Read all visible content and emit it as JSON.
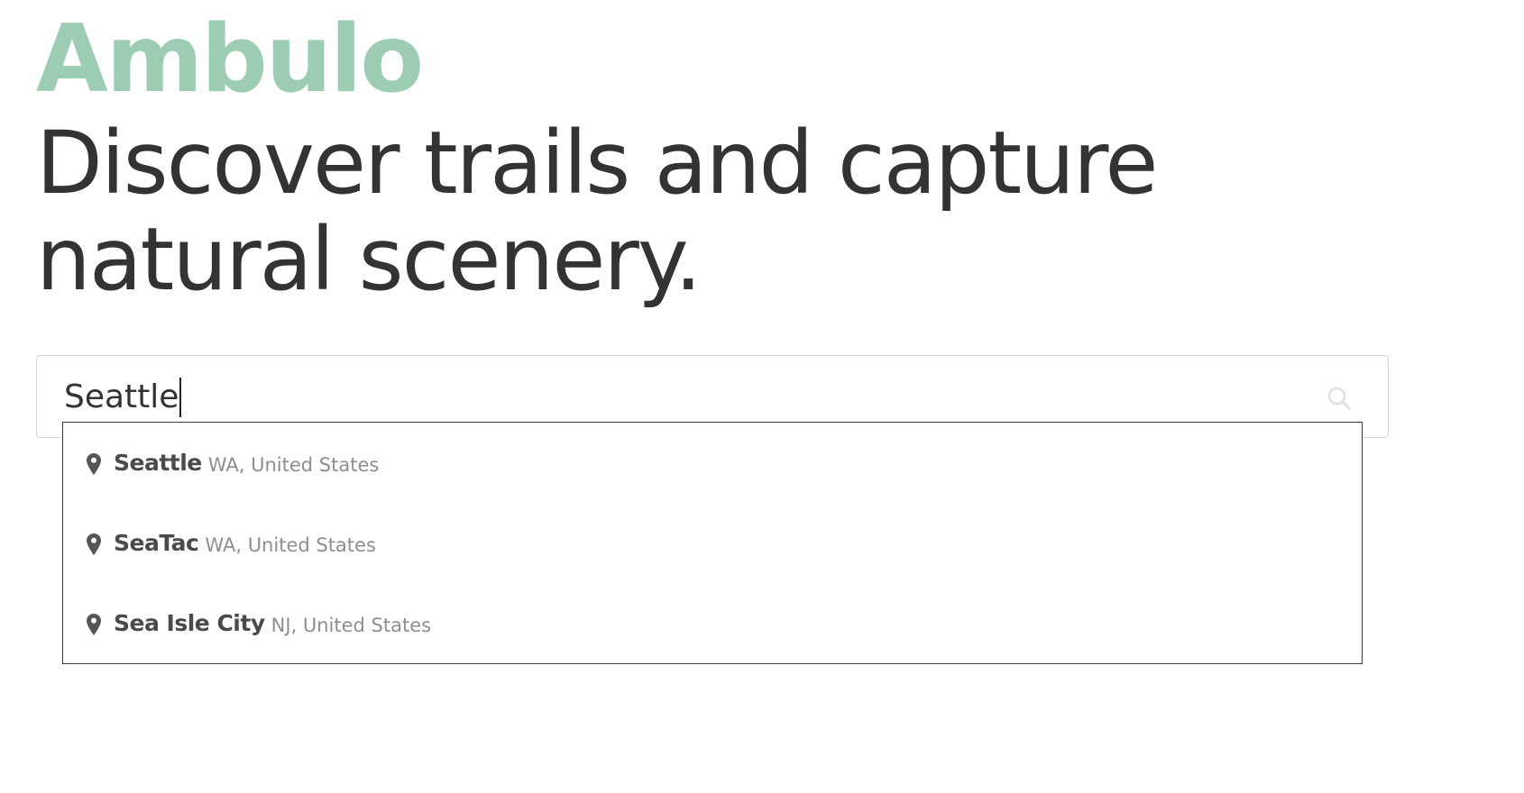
{
  "brand": {
    "name": "Ambulo",
    "color": "#9ccdb3"
  },
  "hero": {
    "headline_line1": "Discover trails and capture",
    "headline_line2": "natural scenery."
  },
  "search": {
    "value": "Seattle",
    "icon": "search-icon"
  },
  "suggestions": [
    {
      "name": "Seattle",
      "region": "WA, United States",
      "icon": "map-pin-icon"
    },
    {
      "name": "SeaTac",
      "region": "WA, United States",
      "icon": "map-pin-icon"
    },
    {
      "name": "Sea Isle City",
      "region": "NJ, United States",
      "icon": "map-pin-icon"
    }
  ]
}
